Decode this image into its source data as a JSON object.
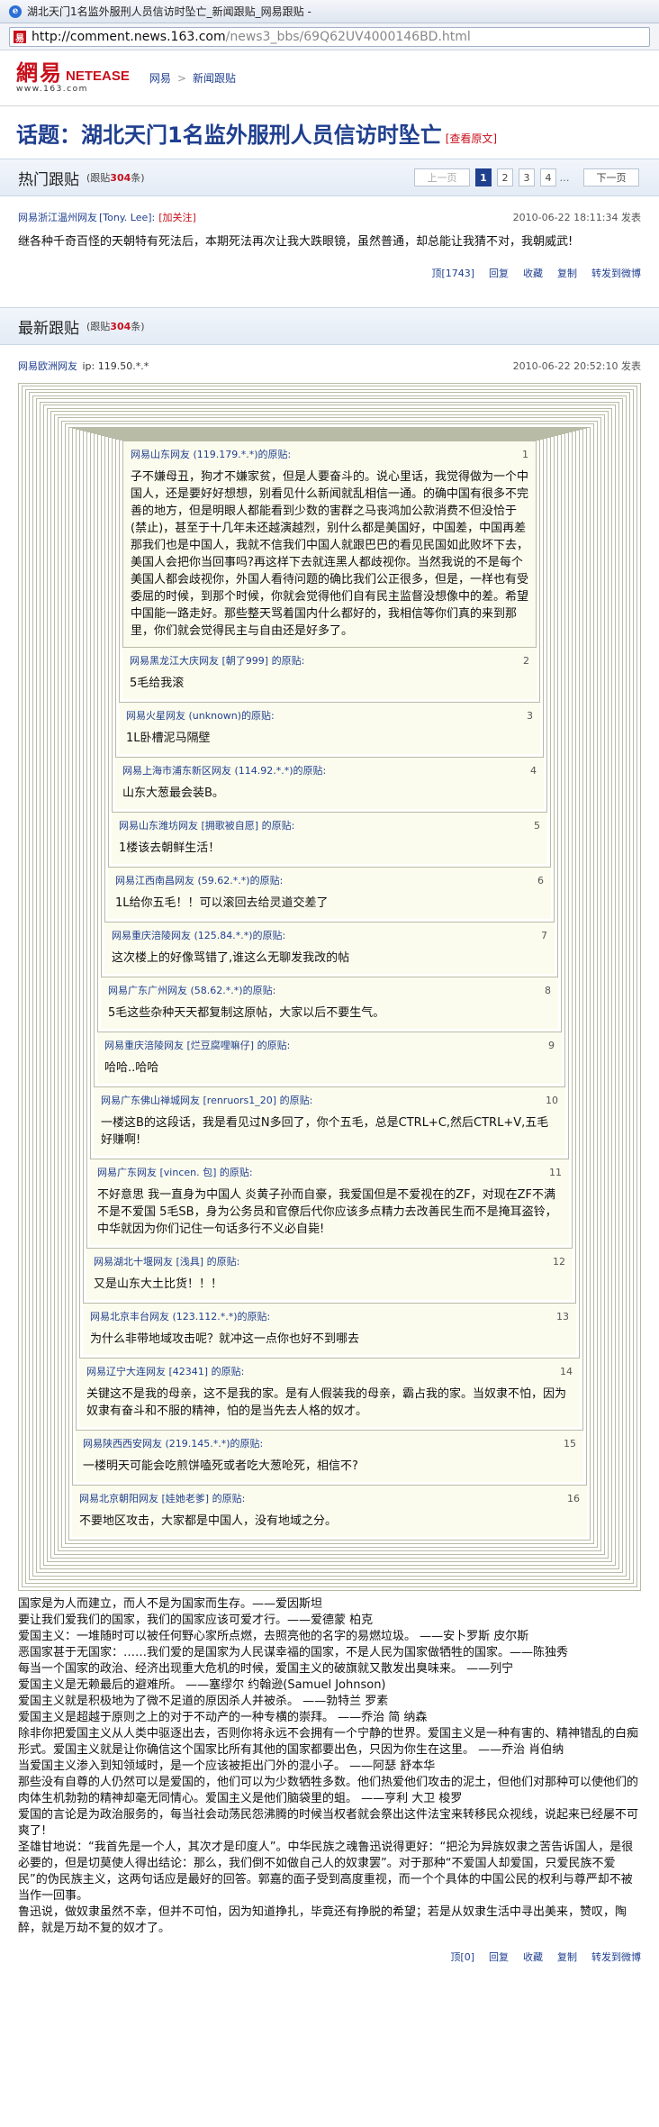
{
  "browser": {
    "title": "湖北天门1名监外服刑人员信访时坠亡_新闻跟贴_网易跟贴 -",
    "url_host": "http://comment.news.163.com",
    "url_path": "/news3_bbs/69Q62UV4000146BD.html"
  },
  "site": {
    "logo_cn": "網易",
    "logo_en": "NETEASE",
    "logo_domain": "www.163.com",
    "breadcrumb": [
      "网易",
      "新闻跟贴"
    ]
  },
  "topic": {
    "label": "话题：",
    "title": "湖北天门1名监外服刑人员信访时坠亡",
    "orig_link": "[查看原文]"
  },
  "hot": {
    "title": "热门跟贴",
    "count_prefix": "(跟贴",
    "count": "304",
    "count_suffix": "条)",
    "pager": {
      "prev": "上一页",
      "pages": [
        "1",
        "2",
        "3",
        "4"
      ],
      "dots": "…",
      "next": "下一页"
    },
    "post": {
      "user": "网易浙江温州网友",
      "uname": "[Tony. Lee]:",
      "follow": "[加关注]",
      "time": "2010-06-22 18:11:34 发表",
      "body": "继各种千奇百怪的天朝特有死法后，本期死法再次让我大跌眼镜，虽然普通，却总能让我猜不对，我朝威武!",
      "votes": "顶[1743]",
      "actions": [
        "回复",
        "收藏",
        "复制",
        "转发到微博"
      ]
    }
  },
  "latest": {
    "title": "最新跟贴",
    "count_prefix": "(跟贴",
    "count": "304",
    "count_suffix": "条)",
    "post": {
      "user": "网易欧洲网友",
      "ip": "ip: 119.50.*.*",
      "time": "2010-06-22 20:52:10 发表",
      "quotes": [
        {
          "who": "网易山东网友 (119.179.*.*)的原贴:",
          "floor": "1",
          "body": "子不嫌母丑，狗才不嫌家贫，但是人要奋斗的。说心里话，我觉得做为一个中国人，还是要好好想想，别看见什么新闻就乱相信一通。的确中国有很多不完善的地方，但是明眼人都能看到少数的害群之马丧鸿加公款消费不但没恰于(禁止)，甚至于十几年未还越演越烈，别什么都是美国好，中国差，中国再差那我们也是中国人，我就不信我们中国人就跟巴巴的看见民国如此败坏下去，美国人会把你当回事吗?再这样下去就连黑人都歧视你。当然我说的不是每个美国人都会歧视你，外国人看待问题的确比我们公正很多，但是，一样也有受委屈的时候，到那个时候，你就会觉得他们自有民主监督没想像中的差。希望中国能一路走好。那些整天骂着国内什么都好的，我相信等你们真的来到那里，你们就会觉得民主与自由还是好多了。"
        },
        {
          "who": "网易黑龙江大庆网友 [朝了999] 的原贴:",
          "floor": "2",
          "body": "5毛给我滚"
        },
        {
          "who": "网易火星网友 (unknown)的原贴:",
          "floor": "3",
          "body": "1L卧槽泥马隔壁"
        },
        {
          "who": "网易上海市浦东新区网友 (114.92.*.*)的原贴:",
          "floor": "4",
          "body": "山东大葱最会装B。"
        },
        {
          "who": "网易山东潍坊网友 [拥歌被自愿] 的原贴:",
          "floor": "5",
          "body": "1楼该去朝鲜生活！"
        },
        {
          "who": "网易江西南昌网友 (59.62.*.*)的原贴:",
          "floor": "6",
          "body": "1L给你五毛！！可以滚回去给灵道交差了"
        },
        {
          "who": "网易重庆涪陵网友 (125.84.*.*)的原贴:",
          "floor": "7",
          "body": "这次楼上的好像骂错了,谁这么无聊发我改的帖"
        },
        {
          "who": "网易广东广州网友 (58.62.*.*)的原贴:",
          "floor": "8",
          "body": "5毛这些杂种天天都复制这原帖，大家以后不要生气。"
        },
        {
          "who": "网易重庆涪陵网友 [烂豆腐哩嘛仔] 的原贴:",
          "floor": "9",
          "body": "哈哈..哈哈"
        },
        {
          "who": "网易广东佛山禅城网友 [renruors1_20] 的原贴:",
          "floor": "10",
          "body": "一楼这B的这段话，我是看见过N多回了，你个五毛，总是CTRL+C,然后CTRL+V,五毛好赚啊!"
        },
        {
          "who": "网易广东网友 [vincen. 包] 的原贴:",
          "floor": "11",
          "body": "不好意思  我一直身为中国人  炎黄子孙而自豪，我爱国但是不爱视在的ZF，对现在ZF不满不是不爱国  5毛SB，身为公务员和官僚后代你应该多点精力去改善民生而不是掩耳盗铃，中华就因为你们记住一句话多行不义必自毙!"
        },
        {
          "who": "网易湖北十堰网友 [浅具] 的原贴:",
          "floor": "12",
          "body": "又是山东大土比货！！！"
        },
        {
          "who": "网易北京丰台网友 (123.112.*.*)的原贴:",
          "floor": "13",
          "body": "为什么非带地域攻击呢？就冲这一点你也好不到哪去"
        },
        {
          "who": "网易辽宁大连网友 [42341] 的原贴:",
          "floor": "14",
          "body": "关键这不是我的母亲，这不是我的家。是有人假装我的母亲，霸占我的家。当奴隶不怕，因为奴隶有奋斗和不服的精神，怕的是当先去人格的奴才。"
        },
        {
          "who": "网易陕西西安网友 (219.145.*.*)的原贴:",
          "floor": "15",
          "body": "一楼明天可能会吃煎饼嗑死或者吃大葱呛死，相信不?"
        },
        {
          "who": "网易北京朝阳网友 [娃她老爹] 的原贴:",
          "floor": "16",
          "body": "不要地区攻击，大家都是中国人，没有地域之分。"
        }
      ],
      "closing": [
        "国家是为人而建立，而人不是为国家而生存。——爱因斯坦",
        "要让我们爱我们的国家，我们的国家应该可爱才行。——爱德蒙 柏克",
        "爱国主义：一堆随时可以被任何野心家所点燃，去照亮他的名字的易燃垃圾。 ——安卜罗斯 皮尔斯",
        "恶国家甚于无国家：……我们爱的是国家为人民谋幸福的国家，不是人民为国家做牺牲的国家。——陈独秀",
        "每当一个国家的政治、经济出现重大危机的时候，爱国主义的破旗就又散发出臭味来。 ——列宁",
        "爱国主义是无赖最后的避难所。 ——塞缪尔 约翰逊(Samuel Johnson)",
        "爱国主义就是积极地为了微不足道的原因杀人并被杀。 ——勃特兰 罗素",
        "爱国主义是超越于原则之上的对于不动产的一种专横的崇拜。 ——乔治 简 纳森",
        "除非你把爱国主义从人类中驱逐出去，否则你将永远不会拥有一个宁静的世界。爱国主义是一种有害的、精神错乱的白痴形式。爱国主义就是让你确信这个国家比所有其他的国家都要出色，只因为你生在这里。 ——乔治 肖伯纳",
        "当爱国主义渗入到知领域时，是一个应该被拒出门外的混小子。 ——阿瑟 舒本华",
        "那些没有自尊的人仍然可以是爱国的，他们可以为少数牺牲多数。他们热爱他们攻击的泥土，但他们对那种可以使他们的肉体生机勃勃的精神却毫无同情心。爱国主义是他们脑袋里的蛆。 ——亨利 大卫 梭罗",
        "爱国的言论是为政治服务的，每当社会动荡民怨沸腾的时候当权者就会祭出这件法宝来转移民众视线，说起来已经屡不可爽了!",
        "圣雄甘地说：“我首先是一个人，其次才是印度人”。中华民族之魂鲁迅说得更好：“把沦为异族奴隶之苦告诉国人，是很必要的，但是切莫使人得出结论：那么，我们倒不如做自己人的奴隶罢”。对于那种“不爱国人却爱国，只爱民族不爱民”的伪民族主义，这两句话应是最好的回答。郭嘉的面子受到高度重视，而一个个具体的中国公民的权利与尊严却不被当作一回事。",
        "鲁迅说，做奴隶虽然不幸，但并不可怕，因为知道挣扎，毕竟还有挣脱的希望；若是从奴隶生活中寻出美来，赞叹，陶醉，就是万劫不复的奴才了。"
      ],
      "votes": "顶[0]",
      "actions": [
        "回复",
        "收藏",
        "复制",
        "转发到微博"
      ]
    }
  }
}
